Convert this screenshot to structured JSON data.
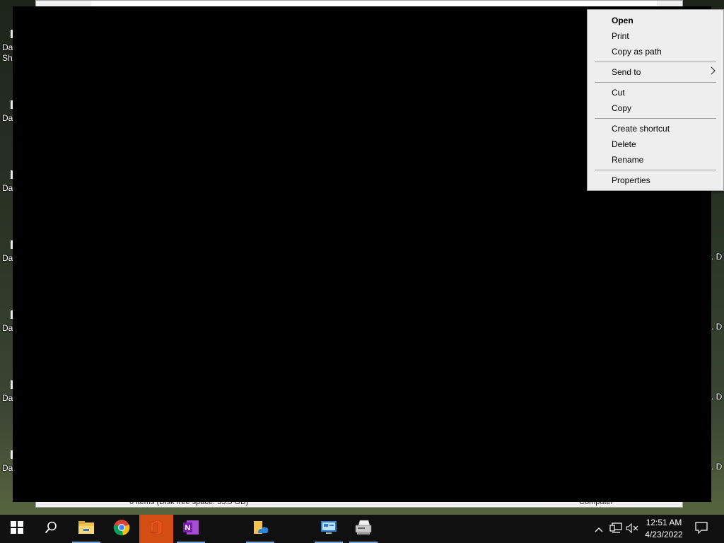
{
  "desktop": {
    "left_icons": [
      {
        "label": "Da\nSh"
      },
      {
        "label": "Da"
      },
      {
        "label": "Da"
      },
      {
        "label": "Da"
      },
      {
        "label": "Da"
      },
      {
        "label": "Da"
      },
      {
        "label": "Da"
      }
    ],
    "right_icons": [
      {
        "label": ". D"
      },
      {
        "label": ". D"
      },
      {
        "label": ". D"
      },
      {
        "label": ". D"
      }
    ]
  },
  "explorer": {
    "status_left": "0 items (Disk free space: 35.5 GB)",
    "status_right": "Computer"
  },
  "context_menu": {
    "items": [
      {
        "label": "Open",
        "bold": true
      },
      {
        "label": "Print"
      },
      {
        "label": "Copy as path"
      },
      {
        "label": "Send to",
        "submenu": true
      },
      {
        "label": "Cut"
      },
      {
        "label": "Copy"
      },
      {
        "label": "Create shortcut"
      },
      {
        "label": "Delete"
      },
      {
        "label": "Rename"
      },
      {
        "label": "Properties"
      }
    ]
  },
  "taskbar": {
    "apps": [
      {
        "name": "start-icon"
      },
      {
        "name": "search-icon"
      },
      {
        "name": "file-explorer-icon"
      },
      {
        "name": "chrome-icon"
      },
      {
        "name": "office-icon"
      },
      {
        "name": "onenote-icon"
      },
      {
        "name": "onedrive-folder-icon"
      },
      {
        "name": "control-panel-icon"
      },
      {
        "name": "fax-scan-icon"
      }
    ],
    "tray": {
      "chevron": "^",
      "network": "network-icon",
      "volume": "volume-muted-icon"
    },
    "clock": {
      "time": "12:51 AM",
      "date": "4/23/2022"
    },
    "notification": "notification-icon"
  },
  "colors": {
    "taskbar_bg": "#101010",
    "active_app": "#d44d12",
    "menu_bg": "#eeeeee"
  }
}
